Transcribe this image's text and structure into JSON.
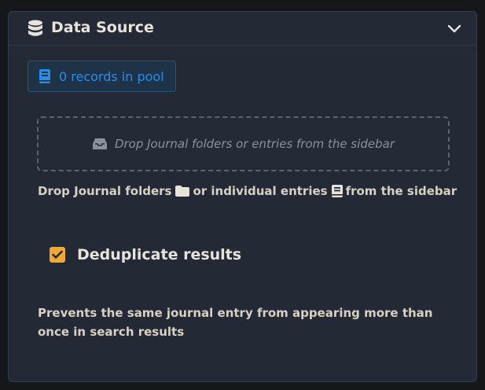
{
  "panel": {
    "title": "Data Source",
    "title_icon": "database-icon",
    "collapse_icon": "chevron-down-icon"
  },
  "records": {
    "icon": "book-icon",
    "label": "0 records in pool"
  },
  "drop_zone": {
    "icon": "inbox-icon",
    "placeholder": "Drop Journal folders or entries from the sidebar"
  },
  "help": {
    "part1": "Drop Journal folders",
    "icon1": "folder-icon",
    "part2": "or individual entries",
    "icon2": "journal-entry-icon",
    "part3": "from the sidebar"
  },
  "dedupe": {
    "label": "Deduplicate results",
    "checked": true,
    "description": "Prevents the same journal entry from appearing more than once in search results"
  },
  "colors": {
    "background": "#15171b",
    "panel": "#232a36",
    "accent_blue": "#2b8ce6",
    "checkbox": "#f0a838",
    "text": "#e8e3da"
  }
}
